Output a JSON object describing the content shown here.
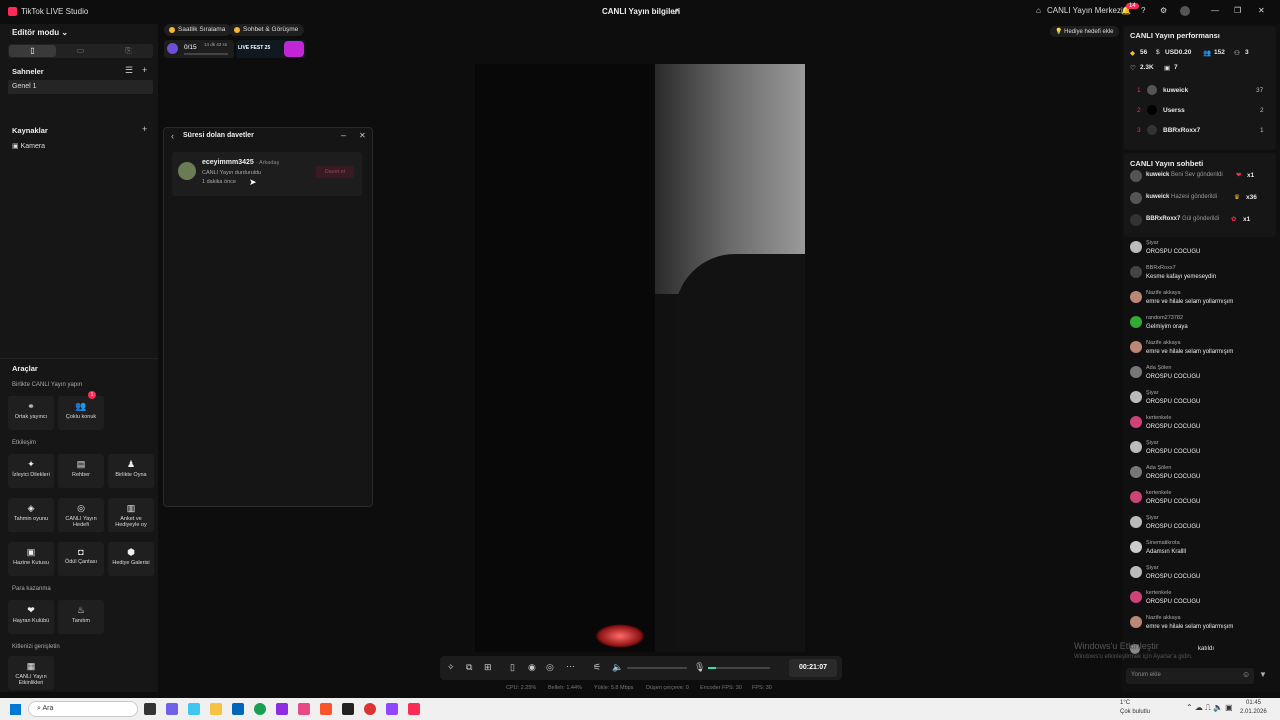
{
  "titlebar": {
    "app": "TikTok LIVE Studio",
    "center": "CANLI Yayın bilgileri",
    "live_center": "CANLI Yayın Merkezi",
    "notif_count": "14"
  },
  "left": {
    "mode": "Editör modu",
    "scenes_title": "Sahneler",
    "scene1": "Genel 1",
    "sources_title": "Kaynaklar",
    "source1": "Kamera"
  },
  "tools": {
    "title": "Araçlar",
    "g1": "Birlikte CANLI Yayın yapın",
    "g2": "Etkileşim",
    "g3": "Para kazanma",
    "g4": "Kitlenizi genişletin",
    "items": [
      "Ortak yayıncı",
      "Çoklu konuk",
      "İzleyici Dilekleri",
      "Rehber",
      "Birlikte Oyna",
      "Tahmin oyunu",
      "CANLI Yayın Hedefi",
      "Anket ve Hediyeyle oy",
      "Hazine Kutusu",
      "Ödül Çantası",
      "Hediye Galerisi",
      "Hayran Kulübü",
      "Tanıtım",
      "CANLI Yayın Etkinlikleri"
    ],
    "badge": "1"
  },
  "tags": {
    "t1": "Saatlik Sıralama",
    "t2": "Sohbet & Görüşme",
    "progress": "0/15",
    "timer": "14 dk 43 sn",
    "fest": "LIVE FEST 25"
  },
  "dialog": {
    "title": "Süresi dolan davetler",
    "name": "eceyimmm3425",
    "rel": "· Arkadaş",
    "status": "CANLI Yayın durduruldu",
    "time": "1 dakika önce",
    "btn": "Davet et"
  },
  "gift_goal": "Hediye hedefi ekle",
  "perf": {
    "title": "CANLI Yayın performansı",
    "s1": "56",
    "s2": "USD0.20",
    "s3": "152",
    "s4": "3",
    "s5": "2.3K",
    "s6": "7",
    "rank": [
      {
        "n": "1",
        "name": "kuweick",
        "v": "37"
      },
      {
        "n": "2",
        "name": "Userss",
        "v": "2"
      },
      {
        "n": "3",
        "name": "BBRxRoxx7",
        "v": "1"
      }
    ]
  },
  "chat": {
    "title": "CANLI Yayın sohbeti",
    "gifts": [
      {
        "name": "kuweick",
        "text": "Beni Sev gönderildi",
        "x": "x1"
      },
      {
        "name": "kuweick",
        "text": "Hazesi gönderildi",
        "x": "x36"
      },
      {
        "name": "BBRxRoxx7",
        "text": "Gül gönderildi",
        "x": "x1"
      }
    ],
    "msgs": [
      {
        "n": "Şiyar",
        "t": "OROSPU COCUGU"
      },
      {
        "n": "BBRxRoxx7",
        "t": "Kesme kafayı yemeseydin"
      },
      {
        "n": "Nazife akkaya",
        "t": "emre ve hilale selam yollarmışım"
      },
      {
        "n": "random273782",
        "t": "Gelmiyim oraya"
      },
      {
        "n": "Nazife akkaya",
        "t": "emre ve hilale selam yollarmışım"
      },
      {
        "n": "Ada Şölen",
        "t": "OROSPU COCUGU"
      },
      {
        "n": "Şiyar",
        "t": "OROSPU COCUGU"
      },
      {
        "n": "kertenkele",
        "t": "OROSPU COCUGU"
      },
      {
        "n": "Şiyar",
        "t": "OROSPU COCUGU"
      },
      {
        "n": "Ada Şölen",
        "t": "OROSPU COCUGU"
      },
      {
        "n": "kertenkele",
        "t": "OROSPU COCUGU"
      },
      {
        "n": "Şiyar",
        "t": "OROSPU COCUGU"
      },
      {
        "n": "Sinematikrota",
        "t": "Adamsın Krallll"
      },
      {
        "n": "Şiyar",
        "t": "OROSPU COCUGU"
      },
      {
        "n": "kertenkele",
        "t": "OROSPU COCUGU"
      },
      {
        "n": "Nazife akkaya",
        "t": "emre ve hilale selam yollarmışım"
      }
    ],
    "joined": "katıldı",
    "placeholder": "Yorum ekle"
  },
  "controls": {
    "timer": "00:21:07"
  },
  "stats": {
    "cpu": "CPU: 2.25%",
    "bitrate": "Belleh: 1.44%",
    "upload": "Yükle: 5.8 Mbps",
    "drop": "Düşen çerçeve: 0",
    "enc": "Encoder FPS: 30",
    "fps": "FPS: 30"
  },
  "watermark": {
    "l1": "Windows'u Etkinleştir",
    "l2": "Windows'u etkinleştirmek için Ayarlar'a gidin."
  },
  "taskbar": {
    "search": "Ara",
    "weather_t": "1°C",
    "weather": "Çok bulutlu",
    "time": "01:45",
    "date": "2.01.2026"
  },
  "colors": {
    "accent": "#fe2c55",
    "bg": "#0d0d0d",
    "panel": "#161616"
  }
}
